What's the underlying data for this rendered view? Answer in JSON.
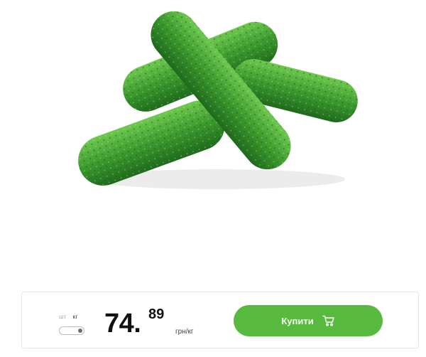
{
  "product": {
    "image_icon": "cucumbers-photo"
  },
  "buy_bar": {
    "unit_switch": {
      "option_pcs": "шт",
      "option_kg": "кг",
      "selected": "кг"
    },
    "price": {
      "integer": "74.",
      "decimal": "89",
      "unit": "грн/кг"
    },
    "buy_button": {
      "label": "Купити",
      "icon": "cart-icon"
    }
  },
  "colors": {
    "accent": "#58b93f",
    "cucumber": "#3c9a2e"
  }
}
